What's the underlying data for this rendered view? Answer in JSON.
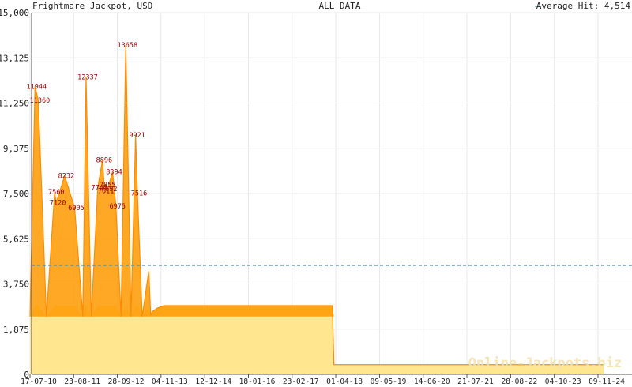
{
  "header": {
    "title": "Frightmare Jackpot, USD",
    "range": "ALL DATA",
    "average_label": "Average Hit: 4,514"
  },
  "watermark": "Online-Jackpots.biz",
  "colors": {
    "line": "#ff8c00",
    "fill_upper": "#ff9900",
    "fill_lower": "#ffe68f",
    "average_line": "#4a8fb0",
    "peak_label": "#990000",
    "grid": "#e8e8e8",
    "axis": "#555555"
  },
  "chart_data": {
    "type": "area",
    "title": "Frightmare Jackpot, USD",
    "xlabel": "",
    "ylabel": "",
    "ylim": [
      0,
      15000
    ],
    "y_ticks": [
      0,
      1875,
      3750,
      5625,
      7500,
      9375,
      11250,
      13125,
      15000
    ],
    "y_tick_labels": [
      "0",
      "1,875",
      "3,750",
      "5,625",
      "7,500",
      "9,375",
      "11,250",
      "13,125",
      "15,000"
    ],
    "x_tick_labels": [
      "17-07-10",
      "23-08-11",
      "28-09-12",
      "04-11-13",
      "12-12-14",
      "18-01-16",
      "23-02-17",
      "01-04-18",
      "09-05-19",
      "14-06-20",
      "21-07-21",
      "28-08-22",
      "04-10-23",
      "09-11-24"
    ],
    "average": 4514,
    "grid": true,
    "series": [
      {
        "points": [
          [
            "17-07-10",
            2400
          ],
          [
            "01-09-10",
            11944
          ],
          [
            "01-10-10",
            11360
          ],
          [
            "15-12-10",
            2400
          ],
          [
            "01-03-11",
            7560
          ],
          [
            "15-03-11",
            7120
          ],
          [
            "01-06-11",
            8232
          ],
          [
            "01-09-11",
            6905
          ],
          [
            "15-11-11",
            2400
          ],
          [
            "15-12-11",
            12337
          ],
          [
            "01-02-12",
            2400
          ],
          [
            "01-04-12",
            7747
          ],
          [
            "15-05-12",
            8896
          ],
          [
            "01-06-12",
            7611
          ],
          [
            "15-06-12",
            7855
          ],
          [
            "01-07-12",
            7692
          ],
          [
            "15-08-12",
            8394
          ],
          [
            "15-09-12",
            6975
          ],
          [
            "01-11-12",
            2400
          ],
          [
            "15-12-12",
            13658
          ],
          [
            "01-02-13",
            2400
          ],
          [
            "15-03-13",
            9921
          ],
          [
            "01-04-13",
            7516
          ],
          [
            "15-05-13",
            2400
          ],
          [
            "15-07-13",
            4300
          ],
          [
            "01-08-13",
            2450
          ],
          [
            "15-08-13",
            2600
          ],
          [
            "01-10-13",
            2750
          ],
          [
            "01-12-13",
            2850
          ],
          [
            "01-03-18",
            2850
          ],
          [
            "15-03-18",
            400
          ],
          [
            "31-12-24",
            400
          ]
        ]
      }
    ],
    "peak_labels": [
      {
        "x": "01-09-10",
        "value": 11944
      },
      {
        "x": "01-10-10",
        "value": 11360
      },
      {
        "x": "01-03-11",
        "value": 7560
      },
      {
        "x": "15-03-11",
        "value": 7120
      },
      {
        "x": "01-06-11",
        "value": 8232
      },
      {
        "x": "01-09-11",
        "value": 6905
      },
      {
        "x": "15-12-11",
        "value": 12337
      },
      {
        "x": "01-04-12",
        "value": 7747
      },
      {
        "x": "15-05-12",
        "value": 8896
      },
      {
        "x": "01-06-12",
        "value": 7611
      },
      {
        "x": "15-06-12",
        "value": 7855
      },
      {
        "x": "01-07-12",
        "value": 7692
      },
      {
        "x": "15-08-12",
        "value": 8394
      },
      {
        "x": "15-09-12",
        "value": 6975
      },
      {
        "x": "15-12-12",
        "value": 13658
      },
      {
        "x": "15-03-13",
        "value": 9921
      },
      {
        "x": "01-04-13",
        "value": 7516
      }
    ]
  }
}
